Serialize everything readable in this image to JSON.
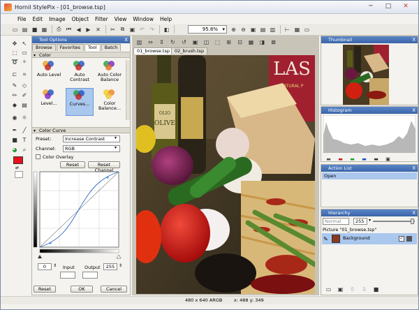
{
  "window": {
    "title": "Hornil StylePix - [01_browse.tsp]",
    "minimize": "─",
    "maximize": "□",
    "close": "✕"
  },
  "menu": [
    "File",
    "Edit",
    "Image",
    "Object",
    "Filter",
    "View",
    "Window",
    "Help"
  ],
  "toolbar": {
    "zoom": "95.8%"
  },
  "tool_options": {
    "title": "Tool Options",
    "close": "X",
    "tabs": [
      "Browse",
      "Favorites",
      "Tool",
      "Batch"
    ],
    "active_tab": "Tool",
    "color_section": "Color",
    "color_items": [
      {
        "label": "Auto Level",
        "selected": false
      },
      {
        "label": "Auto Contrast",
        "selected": false
      },
      {
        "label": "Auto Color Balance",
        "selected": false
      },
      {
        "label": "Level...",
        "selected": false
      },
      {
        "label": "Curves...",
        "selected": true
      },
      {
        "label": "Color Balance...",
        "selected": false
      }
    ],
    "curve_section": "Color Curve",
    "preset_label": "Preset:",
    "preset_value": "Increase Contrast",
    "channel_label": "Channel:",
    "channel_value": "RGB",
    "color_overlay": "Color Overlay",
    "reset_label": "Reset",
    "reset_channel_label": "Reset Channel",
    "input_min": "0",
    "input_max": "255",
    "input_label": "Input",
    "output_label": "Output",
    "bottom_reset": "Reset",
    "ok": "OK",
    "cancel": "Cancel"
  },
  "documents": {
    "tabs": [
      "01_browse.tsp",
      "02_brush.tsp"
    ],
    "active": "01_browse.tsp"
  },
  "image_labels": {
    "olive": "OLIO\nOLIVE",
    "las": "LAS",
    "natural": "NATURAL P"
  },
  "thumbnail": {
    "title": "Thumbnail",
    "close": "X"
  },
  "histogram": {
    "title": "Histogram",
    "close": "X"
  },
  "action_list": {
    "title": "Action List",
    "close": "X",
    "items": [
      "Open"
    ]
  },
  "hierarchy": {
    "title": "Hierarchy",
    "close": "X",
    "mode": "Normal",
    "opacity": "255",
    "picture": "Picture \"01_browse.tsp\"",
    "layer": "Background"
  },
  "status": {
    "dimensions": "480 x 640 ARGB",
    "coords": "x: 488 y: 349"
  },
  "colors": {
    "accent": "#3a64a8",
    "foreground": "#e8101a",
    "background": "#ffffff"
  }
}
